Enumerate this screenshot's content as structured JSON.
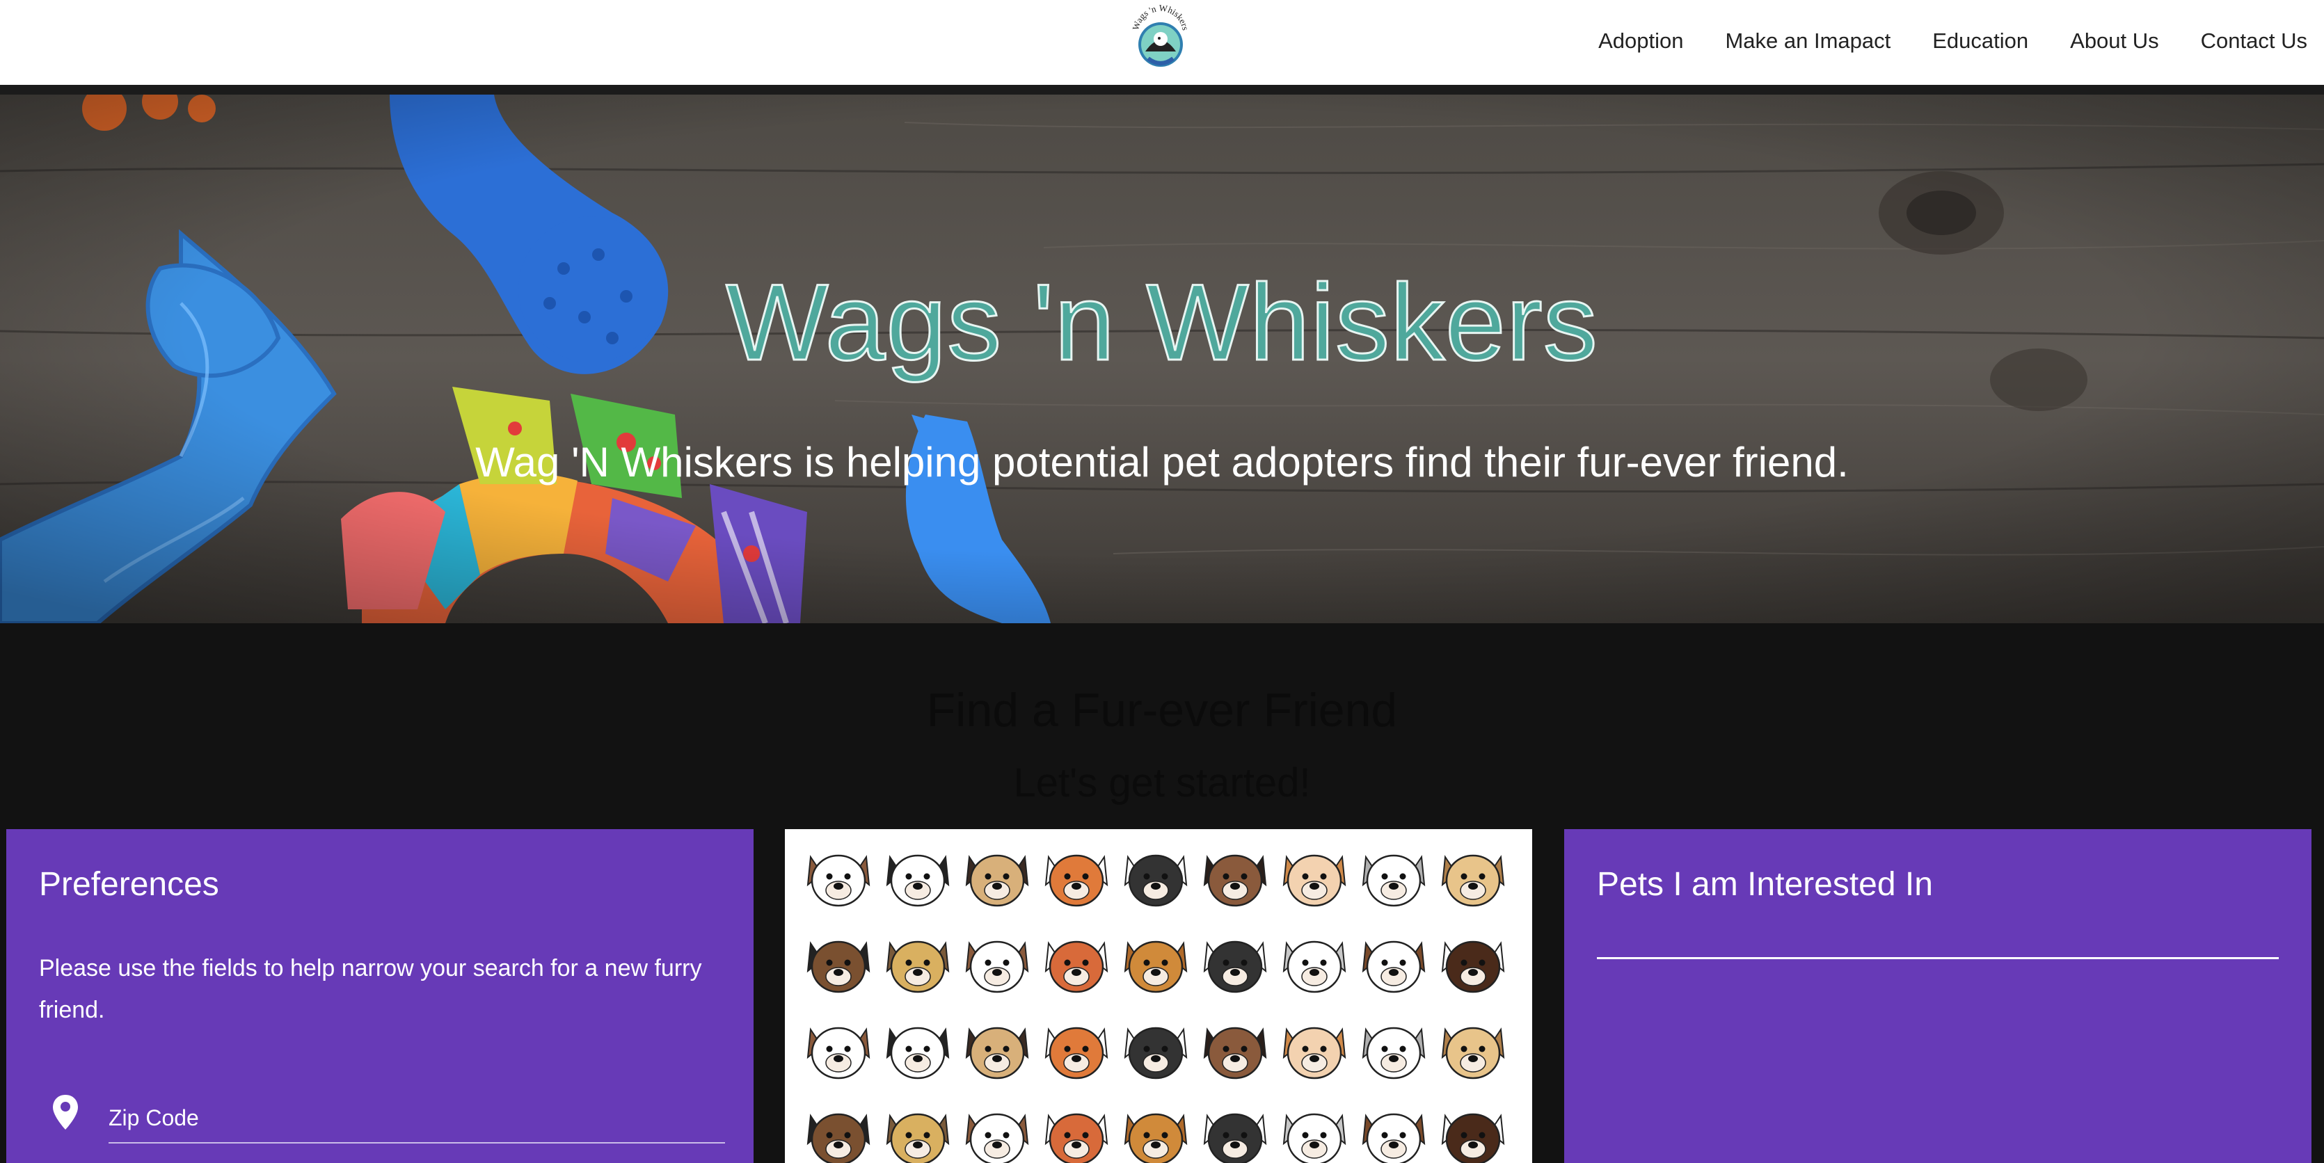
{
  "nav": {
    "logo_text": "Wags 'n Whiskers",
    "links": [
      "Adoption",
      "Make an Imapact",
      "Education",
      "About Us",
      "Contact Us"
    ]
  },
  "hero": {
    "title": "Wags 'n Whiskers",
    "subtitle": "Wag 'N Whiskers is helping potential pet adopters find their fur-ever friend."
  },
  "find": {
    "title": "Find a Fur-ever Friend",
    "subtitle": "Let's get started!"
  },
  "preferences": {
    "title": "Preferences",
    "text": "Please use the fields to help narrow your search for a new furry friend.",
    "zip_placeholder": "Zip Code",
    "zip_icon": "location-pin-icon"
  },
  "interests": {
    "title": "Pets I am Interested In"
  },
  "colors": {
    "accent_purple": "#673ab7",
    "title_teal": "#4fa89c",
    "background_dark": "#121212"
  }
}
